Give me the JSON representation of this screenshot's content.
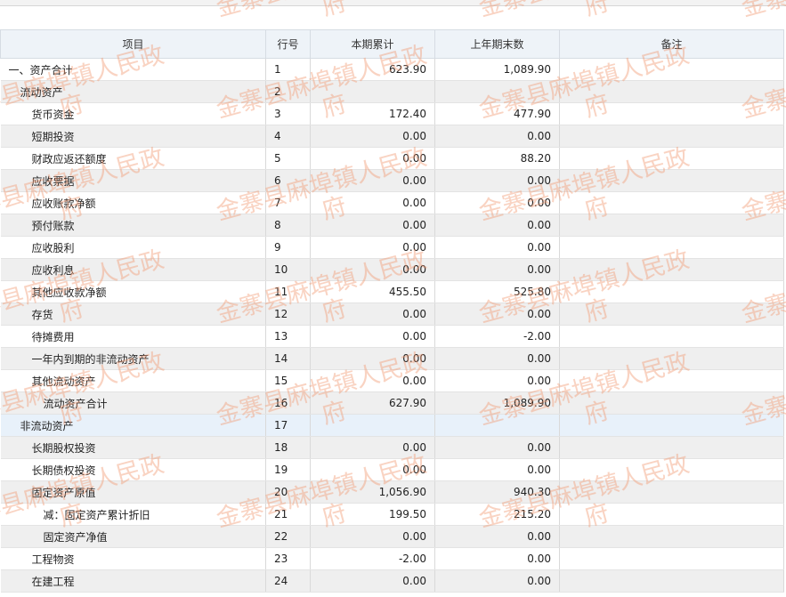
{
  "table": {
    "headers": {
      "item": "项目",
      "line": "行号",
      "current": "本期累计",
      "previous": "上年期末数",
      "note": "备注"
    },
    "rows": [
      {
        "item": "一、资产合计",
        "line": "1",
        "current": "623.90",
        "previous": "1,089.90",
        "note": ""
      },
      {
        "item": "流动资产",
        "line": "2",
        "current": "",
        "previous": "",
        "note": ""
      },
      {
        "item": "货币资金",
        "line": "3",
        "current": "172.40",
        "previous": "477.90",
        "note": ""
      },
      {
        "item": "短期投资",
        "line": "4",
        "current": "0.00",
        "previous": "0.00",
        "note": ""
      },
      {
        "item": "财政应返还额度",
        "line": "5",
        "current": "0.00",
        "previous": "88.20",
        "note": ""
      },
      {
        "item": "应收票据",
        "line": "6",
        "current": "0.00",
        "previous": "0.00",
        "note": ""
      },
      {
        "item": "应收账款净额",
        "line": "7",
        "current": "0.00",
        "previous": "0.00",
        "note": ""
      },
      {
        "item": "预付账款",
        "line": "8",
        "current": "0.00",
        "previous": "0.00",
        "note": ""
      },
      {
        "item": "应收股利",
        "line": "9",
        "current": "0.00",
        "previous": "0.00",
        "note": ""
      },
      {
        "item": "应收利息",
        "line": "10",
        "current": "0.00",
        "previous": "0.00",
        "note": ""
      },
      {
        "item": "其他应收款净额",
        "line": "11",
        "current": "455.50",
        "previous": "525.80",
        "note": ""
      },
      {
        "item": "存货",
        "line": "12",
        "current": "0.00",
        "previous": "0.00",
        "note": ""
      },
      {
        "item": "待摊费用",
        "line": "13",
        "current": "0.00",
        "previous": "-2.00",
        "note": ""
      },
      {
        "item": "一年内到期的非流动资产",
        "line": "14",
        "current": "0.00",
        "previous": "0.00",
        "note": ""
      },
      {
        "item": "其他流动资产",
        "line": "15",
        "current": "0.00",
        "previous": "0.00",
        "note": ""
      },
      {
        "item": "流动资产合计",
        "line": "16",
        "current": "627.90",
        "previous": "1,089.90",
        "note": ""
      },
      {
        "item": "非流动资产",
        "line": "17",
        "current": "",
        "previous": "",
        "note": ""
      },
      {
        "item": "长期股权投资",
        "line": "18",
        "current": "0.00",
        "previous": "0.00",
        "note": ""
      },
      {
        "item": "长期债权投资",
        "line": "19",
        "current": "0.00",
        "previous": "0.00",
        "note": ""
      },
      {
        "item": "固定资产原值",
        "line": "20",
        "current": "1,056.90",
        "previous": "940.30",
        "note": ""
      },
      {
        "item": "减：固定资产累计折旧",
        "line": "21",
        "current": "199.50",
        "previous": "215.20",
        "note": ""
      },
      {
        "item": "固定资产净值",
        "line": "22",
        "current": "0.00",
        "previous": "0.00",
        "note": ""
      },
      {
        "item": "工程物资",
        "line": "23",
        "current": "-2.00",
        "previous": "0.00",
        "note": ""
      },
      {
        "item": "在建工程",
        "line": "24",
        "current": "0.00",
        "previous": "0.00",
        "note": ""
      }
    ]
  },
  "watermark": {
    "line1": "金寨县麻埠镇人民政",
    "line2": "府"
  }
}
